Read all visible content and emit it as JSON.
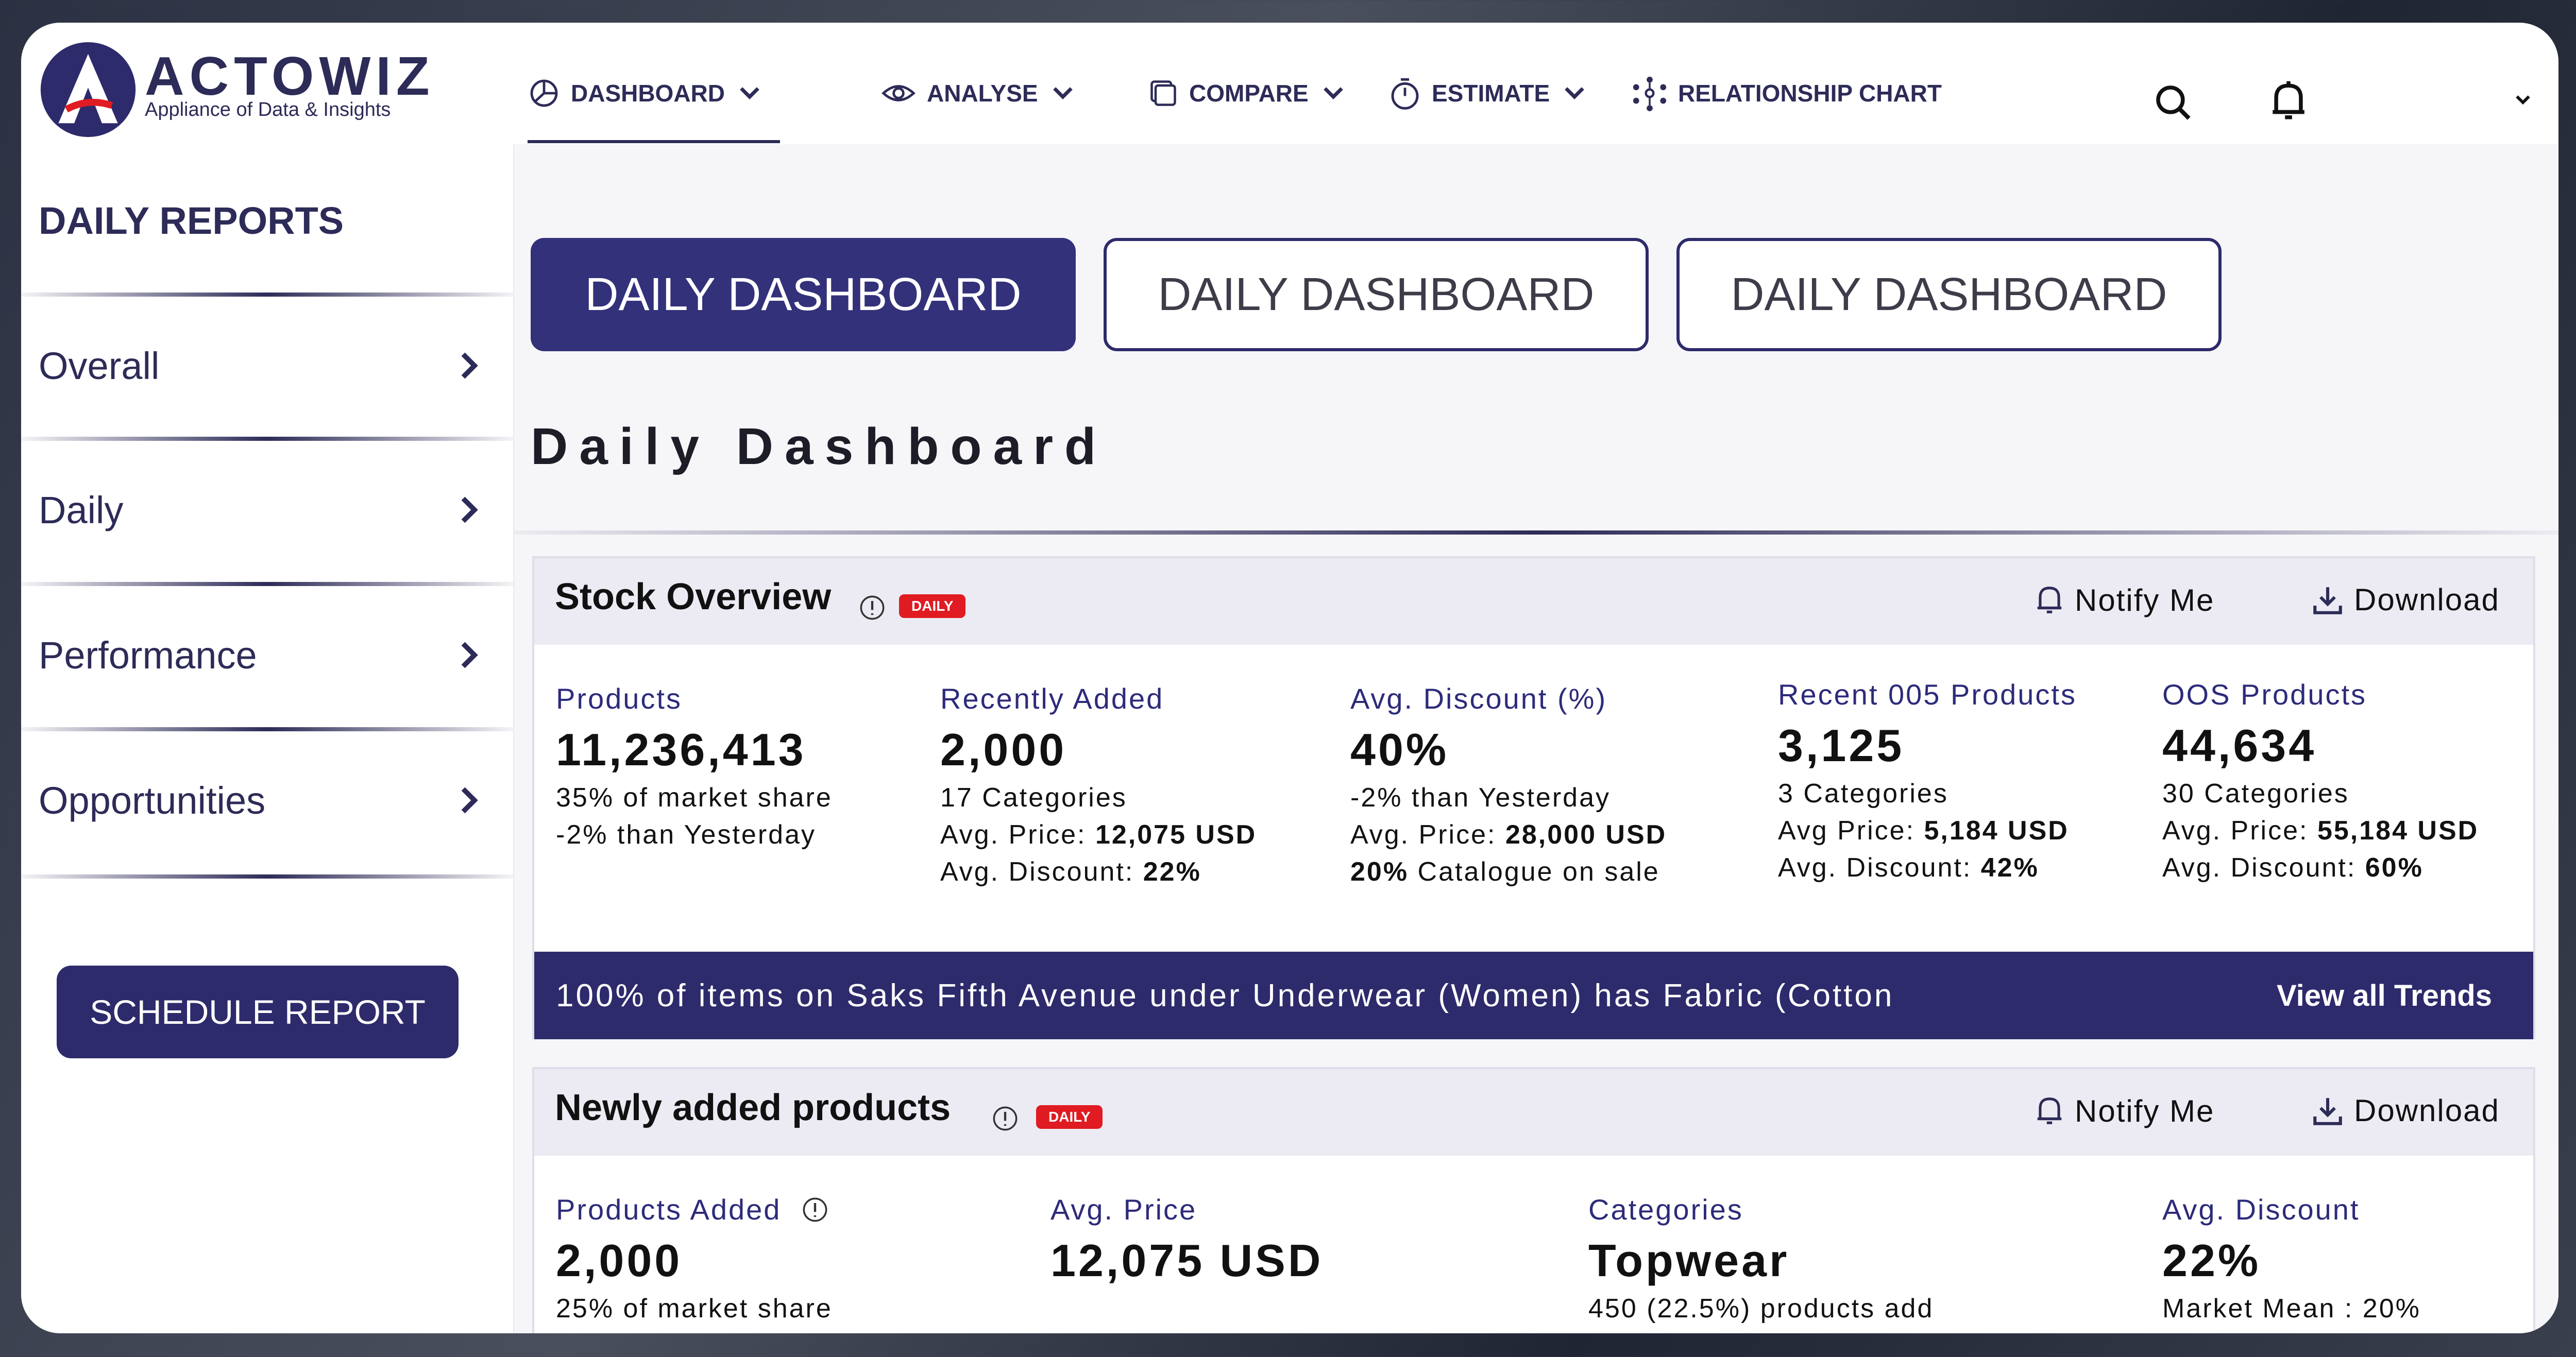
{
  "brand": {
    "name": "ACTOWIZ",
    "tagline": "Appliance of Data & Insights"
  },
  "nav": {
    "items": [
      {
        "label": "DASHBOARD",
        "icon": "pie-chart-icon",
        "dropdown": true,
        "active": true
      },
      {
        "label": "ANALYSE",
        "icon": "eye-icon",
        "dropdown": true
      },
      {
        "label": "COMPARE",
        "icon": "compare-icon",
        "dropdown": true
      },
      {
        "label": "ESTIMATE",
        "icon": "stopwatch-icon",
        "dropdown": true
      },
      {
        "label": "RELATIONSHIP CHART",
        "icon": "network-icon",
        "dropdown": false
      }
    ],
    "right_icons": [
      "search-icon",
      "bell-icon",
      "chevron-down-icon"
    ]
  },
  "sidebar": {
    "title": "DAILY REPORTS",
    "items": [
      {
        "label": "Overall"
      },
      {
        "label": "Daily"
      },
      {
        "label": "Performance"
      },
      {
        "label": "Opportunities"
      }
    ],
    "schedule_button": "SCHEDULE REPORT"
  },
  "tabs": [
    "DAILY DASHBOARD",
    "DAILY DASHBOARD",
    "DAILY DASHBOARD"
  ],
  "page_title": "Daily Dashboard",
  "stock_overview": {
    "title": "Stock Overview",
    "badge": "DAILY",
    "notify": "Notify Me",
    "download": "Download",
    "metrics": [
      {
        "label": "Products",
        "value": "11,236,413",
        "lines": [
          "35% of market share",
          "-2% than Yesterday"
        ]
      },
      {
        "label": "Recently Added",
        "value": "2,000",
        "lines": [
          "17 Categories",
          "Avg. Price: ",
          "Avg. Discount: "
        ],
        "bold": [
          "",
          "12,075 USD",
          "22%"
        ]
      },
      {
        "label": "Avg. Discount (%)",
        "value": "40%",
        "lines": [
          "-2% than Yesterday",
          "Avg. Price: ",
          " Catalogue on sale"
        ],
        "bold": [
          "",
          "28,000 USD",
          "20%"
        ]
      },
      {
        "label": "Recent 005 Products",
        "value": "3,125",
        "lines": [
          "3 Categories",
          "Avg Price: ",
          "Avg. Discount: "
        ],
        "bold": [
          "",
          "5,184 USD",
          "42%"
        ]
      },
      {
        "label": "OOS Products",
        "value": "44,634",
        "lines": [
          "30 Categories",
          "Avg. Price: ",
          "Avg. Discount: "
        ],
        "bold": [
          "",
          "55,184 USD",
          "60%"
        ]
      }
    ],
    "banner_text": "100% of items on Saks Fifth Avenue under Underwear (Women) has Fabric (Cotton",
    "banner_link": "View all Trends"
  },
  "newly_added": {
    "title": "Newly added products",
    "badge": "DAILY",
    "notify": "Notify Me",
    "download": "Download",
    "metrics": [
      {
        "label": "Products Added",
        "value": "2,000",
        "line": "25% of market share"
      },
      {
        "label": "Avg. Price",
        "value": "12,075 USD",
        "line": ""
      },
      {
        "label": "Categories",
        "value": "Topwear",
        "line": "450 (22.5%) products add"
      },
      {
        "label": "Avg. Discount",
        "value": "22%",
        "line": "Market Mean : 20%"
      }
    ]
  }
}
